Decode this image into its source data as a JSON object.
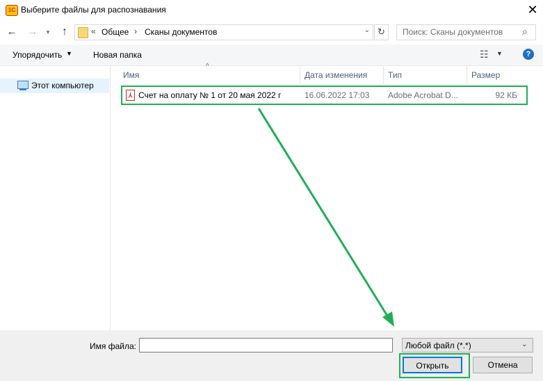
{
  "window": {
    "app_badge": "1C",
    "title": "Выберите файлы для распознавания",
    "close_glyph": "✕"
  },
  "nav": {
    "back_icon": "arrow-left-icon",
    "forward_icon": "arrow-right-icon",
    "up_icon": "arrow-up-icon",
    "chevron": "«",
    "breadcrumb": [
      "Общее",
      "Сканы документов"
    ],
    "separator": "›",
    "search_placeholder": "Поиск: Сканы документов"
  },
  "toolbar": {
    "organize_label": "Упорядочить",
    "new_folder_label": "Новая папка",
    "help_label": "?"
  },
  "sidebar": {
    "items": [
      {
        "label": "Этот компьютер",
        "selected": true
      }
    ]
  },
  "file_list": {
    "columns": [
      "Имя",
      "Дата изменения",
      "Тип",
      "Размер"
    ],
    "rows": [
      {
        "name": "Счет на оплату № 1 от 20 мая 2022 г",
        "date": "16.06.2022 17:03",
        "type": "Adobe Acrobat D...",
        "size": "92 КБ"
      }
    ]
  },
  "bottom": {
    "filename_label": "Имя файла:",
    "filename_value": "",
    "filter_value": "Любой файл (*.*)",
    "open_label": "Открыть",
    "cancel_label": "Отмена"
  },
  "colors": {
    "highlight": "#1fae55",
    "accent": "#0078d7",
    "selection": "#e5f3ff"
  }
}
